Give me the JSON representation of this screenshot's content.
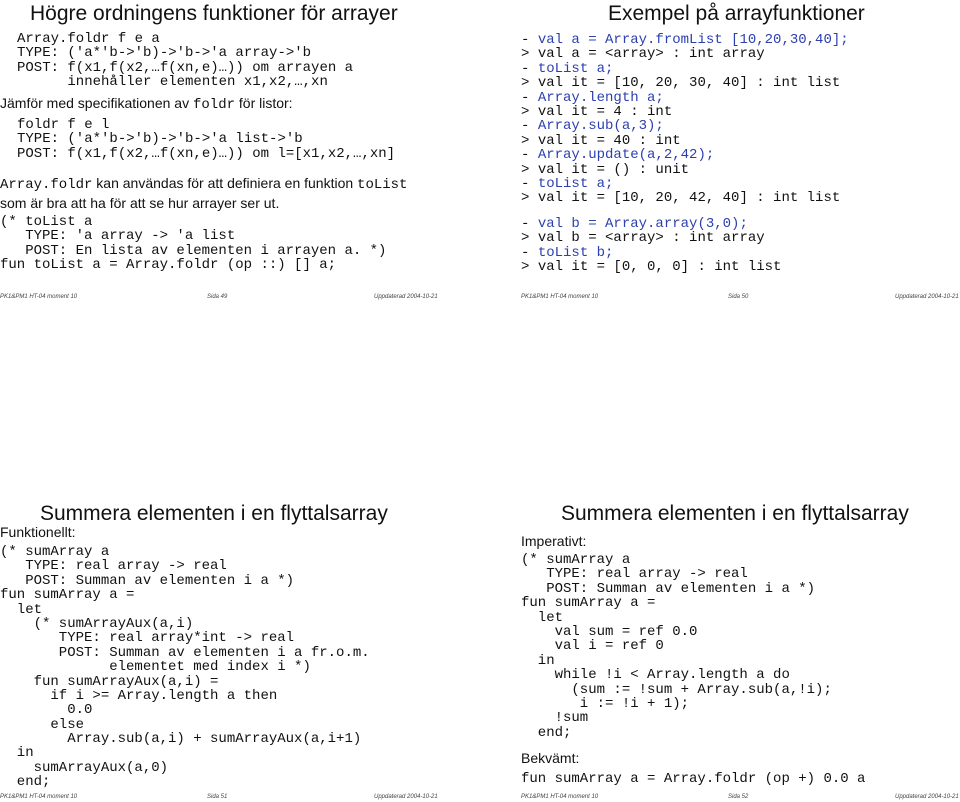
{
  "slides": [
    {
      "title": "Högre ordningens funktioner för arrayer",
      "code1": [
        "Array.foldr f e a",
        "TYPE: ('a*'b->'b)->'b->'a array->'b",
        "POST: f(x1,f(x2,…f(xn,e)…)) om arrayen a",
        "      innehåller elementen x1,x2,…,xn"
      ],
      "prose1": {
        "before": "Jämför med specifikationen av ",
        "code": "foldr",
        "after": " för listor:"
      },
      "code2": [
        "foldr f e l",
        "TYPE: ('a*'b->'b)->'b->'a list->'b",
        "POST: f(x1,f(x2,…f(xn,e)…)) om l=[x1,x2,…,xn]"
      ],
      "prose2": {
        "code1": "Array.foldr",
        "mid": " kan användas för att definiera en funktion ",
        "code2": "toList"
      },
      "prose3": "som är bra att ha för att se hur arrayer ser ut.",
      "code3": [
        "(* toList a",
        "   TYPE: 'a array -> 'a list",
        "   POST: En lista av elementen i arrayen a. *)",
        "fun toList a = Array.foldr (op ::) [] a;"
      ],
      "footer": {
        "left": "PK1&PM1 HT-04 moment 10",
        "center": "Sida 49",
        "right": "Uppdaterad 2004-10-21"
      }
    },
    {
      "title": "Exempel på arrayfunktioner",
      "session1": [
        {
          "prompt": "- ",
          "text": "val a = Array.fromList [10,20,30,40];",
          "kind": "input"
        },
        {
          "prompt": "> ",
          "text": "val a = <array> : int array",
          "kind": "output"
        },
        {
          "prompt": "- ",
          "text": "toList a;",
          "kind": "input"
        },
        {
          "prompt": "> ",
          "text": "val it = [10, 20, 30, 40] : int list",
          "kind": "output"
        },
        {
          "prompt": "- ",
          "text": "Array.length a;",
          "kind": "input"
        },
        {
          "prompt": "> ",
          "text": "val it = 4 : int",
          "kind": "output"
        },
        {
          "prompt": "- ",
          "text": "Array.sub(a,3);",
          "kind": "input"
        },
        {
          "prompt": "> ",
          "text": "val it = 40 : int",
          "kind": "output"
        },
        {
          "prompt": "- ",
          "text": "Array.update(a,2,42);",
          "kind": "input"
        },
        {
          "prompt": "> ",
          "text": "val it = () : unit",
          "kind": "output"
        },
        {
          "prompt": "- ",
          "text": "toList a;",
          "kind": "input"
        },
        {
          "prompt": "> ",
          "text": "val it = [10, 20, 42, 40] : int list",
          "kind": "output"
        }
      ],
      "session2": [
        {
          "prompt": "- ",
          "text": "val b = Array.array(3,0);",
          "kind": "input"
        },
        {
          "prompt": "> ",
          "text": "val b = <array> : int array",
          "kind": "output"
        },
        {
          "prompt": "- ",
          "text": "toList b;",
          "kind": "input"
        },
        {
          "prompt": "> ",
          "text": "val it = [0, 0, 0] : int list",
          "kind": "output"
        }
      ],
      "footer": {
        "left": "PK1&PM1 HT-04 moment 10",
        "center": "Sida 50",
        "right": "Uppdaterad 2004-10-21"
      }
    },
    {
      "title": "Summera elementen i en flyttalsarray",
      "subtitle": "Funktionellt:",
      "code": [
        "(* sumArray a",
        "   TYPE: real array -> real",
        "   POST: Summan av elementen i a *)",
        "fun sumArray a =",
        "  let",
        "    (* sumArrayAux(a,i)",
        "       TYPE: real array*int -> real",
        "       POST: Summan av elementen i a fr.o.m.",
        "             elementet med index i *)",
        "    fun sumArrayAux(a,i) =",
        "      if i >= Array.length a then",
        "        0.0",
        "      else",
        "        Array.sub(a,i) + sumArrayAux(a,i+1)",
        "  in",
        "    sumArrayAux(a,0)",
        "  end;"
      ],
      "footer": {
        "left": "PK1&PM1 HT-04 moment 10",
        "center": "Sida 51",
        "right": "Uppdaterad 2004-10-21"
      }
    },
    {
      "title": "Summera elementen i en flyttalsarray",
      "subtitle": "Imperativt:",
      "code": [
        "(* sumArray a",
        "   TYPE: real array -> real",
        "   POST: Summan av elementen i a *)",
        "fun sumArray a =",
        "  let",
        "    val sum = ref 0.0",
        "    val i = ref 0",
        "  in",
        "    while !i < Array.length a do",
        "      (sum := !sum + Array.sub(a,!i);",
        "       i := !i + 1);",
        "    !sum",
        "  end;"
      ],
      "subtitle2": "Bekvämt:",
      "code2": "fun sumArray a = Array.foldr (op +) 0.0 a",
      "footer": {
        "left": "PK1&PM1 HT-04 moment 10",
        "center": "Sida 52",
        "right": "Uppdaterad 2004-10-21"
      }
    }
  ],
  "colors": {
    "input": "#2b3fb0",
    "text": "#111111"
  }
}
